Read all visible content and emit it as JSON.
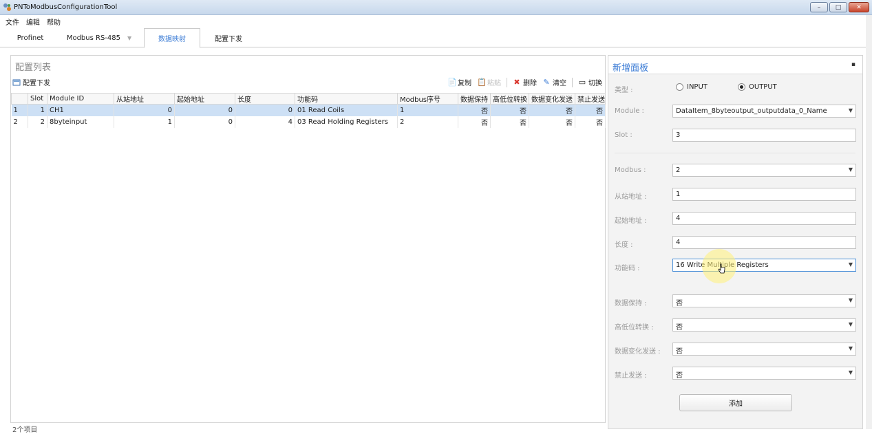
{
  "window": {
    "title": "PNToModbusConfigurationTool",
    "buttons": {
      "min": "–",
      "max": "□",
      "close": "✕"
    }
  },
  "menu": [
    "文件",
    "编辑",
    "帮助"
  ],
  "tabs": [
    {
      "label": "Profinet"
    },
    {
      "label": "Modbus RS-485",
      "caret": "▼"
    },
    {
      "label": "数据映射",
      "active": true
    },
    {
      "label": "配置下发"
    }
  ],
  "config_list": {
    "title": "配置列表",
    "toolbar_left": {
      "label": "配置下发"
    },
    "toolbar_right": [
      "复制",
      "粘贴",
      "删除",
      "清空",
      "切换"
    ],
    "columns": [
      "",
      "Slot",
      "Module ID",
      "从站地址",
      "起始地址",
      "长度",
      "功能码",
      "Modbus序号",
      "数据保持",
      "高低位转换",
      "数据变化发送",
      "禁止发送"
    ],
    "rows": [
      [
        "1",
        "1",
        "CH1",
        "0",
        "0",
        "0",
        "01 Read Coils",
        "1",
        "否",
        "否",
        "否",
        "否"
      ],
      [
        "2",
        "2",
        "8byteinput",
        "1",
        "0",
        "4",
        "03 Read Holding Registers",
        "2",
        "否",
        "否",
        "否",
        "否"
      ]
    ],
    "status": "2个项目"
  },
  "add_panel": {
    "title": "新增面板",
    "pin": "▪",
    "type_label": "类型 :",
    "type_options": [
      "INPUT",
      "OUTPUT"
    ],
    "type_selected": "OUTPUT",
    "module_label": "Module :",
    "module_value": "DataItem_8byteoutput_outputdata_0_Name",
    "slot_label": "Slot :",
    "slot_value": "3",
    "modbus_label": "Modbus :",
    "modbus_value": "2",
    "slave_label": "从站地址 :",
    "slave_value": "1",
    "start_label": "起始地址 :",
    "start_value": "4",
    "length_label": "长度 :",
    "length_value": "4",
    "func_label": "功能码 :",
    "func_value": "16 Write Multiple Registers",
    "hold_label": "数据保持 :",
    "hold_value": "否",
    "swap_label": "高低位转换 :",
    "swap_value": "否",
    "change_label": "数据变化发送 :",
    "change_value": "否",
    "forbid_label": "禁止发送 :",
    "forbid_value": "否",
    "add_button": "添加"
  },
  "colors": {
    "accent": "#3a7bd5",
    "selected_row": "#cde0f5"
  },
  "icons": {
    "arrow": "▼"
  }
}
